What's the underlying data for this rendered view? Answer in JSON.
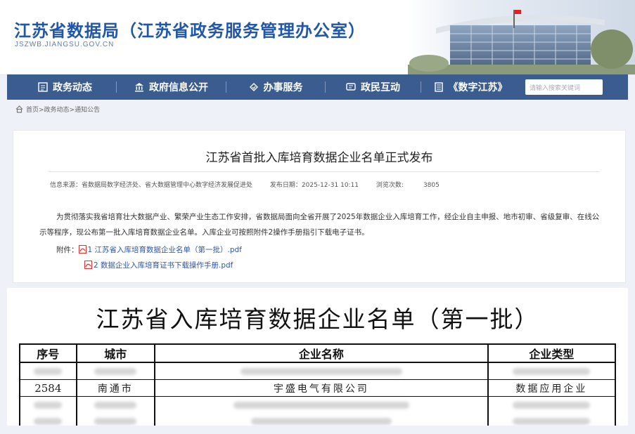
{
  "header": {
    "title": "江苏省数据局（江苏省政务服务管理办公室）",
    "domain": "JSZWB.JIANGSU.GOV.CN"
  },
  "nav": {
    "items": [
      {
        "label": "政务动态",
        "icon": "newspaper-icon"
      },
      {
        "label": "政府信息公开",
        "icon": "bank-icon"
      },
      {
        "label": "办事服务",
        "icon": "handshake-icon"
      },
      {
        "label": "政民互动",
        "icon": "chat-icon"
      },
      {
        "label": "《数字江苏》",
        "icon": "magazine-icon"
      }
    ],
    "search_placeholder": "请输入搜索关键词"
  },
  "breadcrumb": {
    "text": "首页>政务动态>通知公告"
  },
  "article": {
    "title": "江苏省首批入库培育数据企业名单正式发布",
    "meta": {
      "source_label": "信息来源：",
      "source": "省数据局数字经济处、省大数据管理中心数字经济发展促进处",
      "date_label": "发布日期：",
      "date": "2025-12-31 10:11",
      "views_label": "浏览次数:",
      "views": "3805"
    },
    "body": "为贯彻落实我省培育壮大数据产业、繁荣产业生态工作安排，省数据局面向全省开展了2025年数据企业入库培育工作，经企业自主申报、地市初审、省级复审、在线公示等程序，现公布第一批入库培育数据企业名单。入库企业可按照附件2操作手册指引下载电子证书。",
    "attachments_label": "附件：",
    "attachments": [
      "1 江苏省入库培育数据企业名单（第一批）.pdf",
      "2 数据企业入库培育证书下载操作手册.pdf"
    ]
  },
  "document": {
    "title": "江苏省入库培育数据企业名单（第一批）",
    "columns": [
      "序号",
      "城市",
      "企业名称",
      "企业类型"
    ],
    "highlight_row": [
      "2584",
      "南通市",
      "宇盛电气有限公司",
      "数据应用企业"
    ]
  }
}
